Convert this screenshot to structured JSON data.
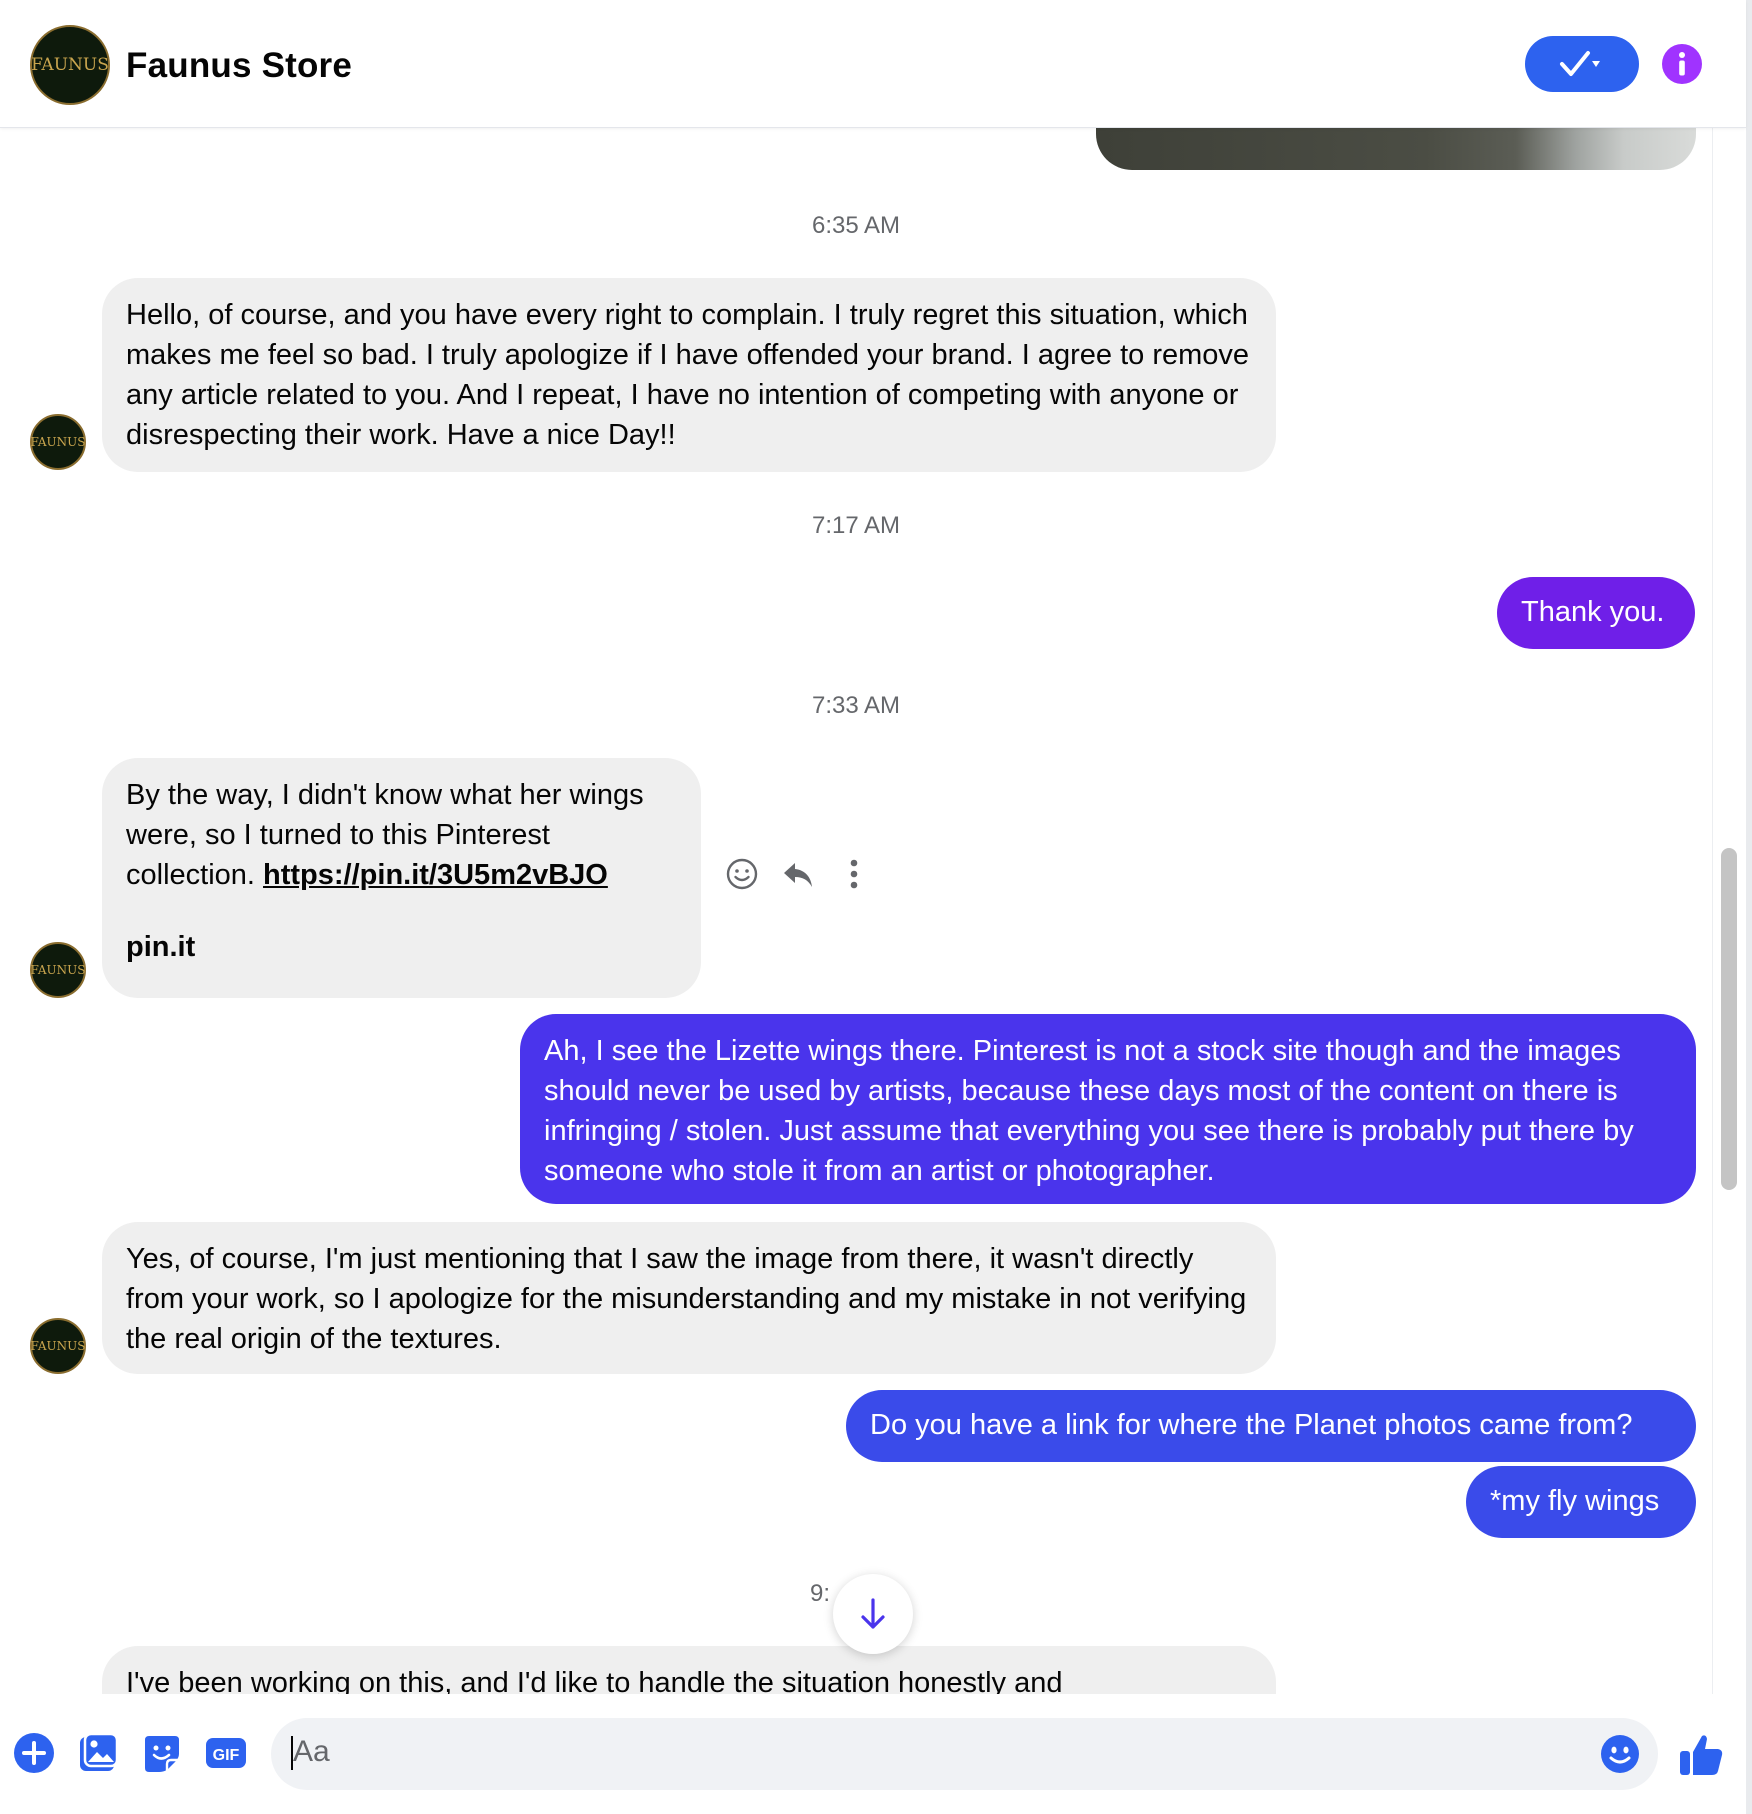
{
  "header": {
    "contact_name": "Faunus Store",
    "avatar_text": "FAUNUS"
  },
  "colors": {
    "accent": "#2d62ef",
    "info": "#a033ff",
    "bubble_in": "#efefef",
    "bubble_out_purple": "#6f1fe8",
    "bubble_out_indigo": "#4a34ec",
    "bubble_out_blue": "#3a4bea"
  },
  "messages": {
    "ts1": "6:35 AM",
    "m1": "Hello, of course, and you have every right to complain. I truly regret this situation, which makes me feel so bad. I truly apologize if I have offended your brand. I agree to remove any article related to you. And I repeat, I have no intention of competing with anyone or disrespecting their work. Have a nice Day!!",
    "ts2": "7:17 AM",
    "m2": "Thank you.",
    "ts3": "7:33 AM",
    "m3_text": "By the way, I didn't know what her wings were, so I turned to this Pinterest collection.",
    "m3_link": "https://pin.it/3U5m2vBJO",
    "m3_domain": "pin.it",
    "m4": "Ah, I see the Lizette wings there. Pinterest is not a stock site though and the images should never be used by artists, because these days most of the content on there is infringing / stolen. Just assume that everything you see there is probably put there by someone who stole it from an artist or photographer.",
    "m5": "Yes, of course, I'm just mentioning that I saw the image from there, it wasn't directly from your work, so I apologize for the misunderstanding and my mistake in not verifying the real origin of the textures.",
    "m6": "Do you have a link for where the Planet photos came from?",
    "m7": "*my fly wings",
    "ts4": "9:",
    "m8": "I've been working on this, and I'd like to handle the situation honestly and"
  },
  "composer": {
    "placeholder": "Aa",
    "gif_label": "GIF"
  },
  "icons": {
    "done": "check-dropdown-icon",
    "info": "info-icon",
    "react": "smiley-icon",
    "reply": "reply-icon",
    "more": "more-vertical-icon",
    "scroll_down": "arrow-down-icon",
    "add": "plus-circle-icon",
    "gallery": "gallery-icon",
    "sticker": "sticker-icon",
    "gif": "gif-icon",
    "emoji": "emoji-icon",
    "like": "thumbs-up-icon"
  }
}
